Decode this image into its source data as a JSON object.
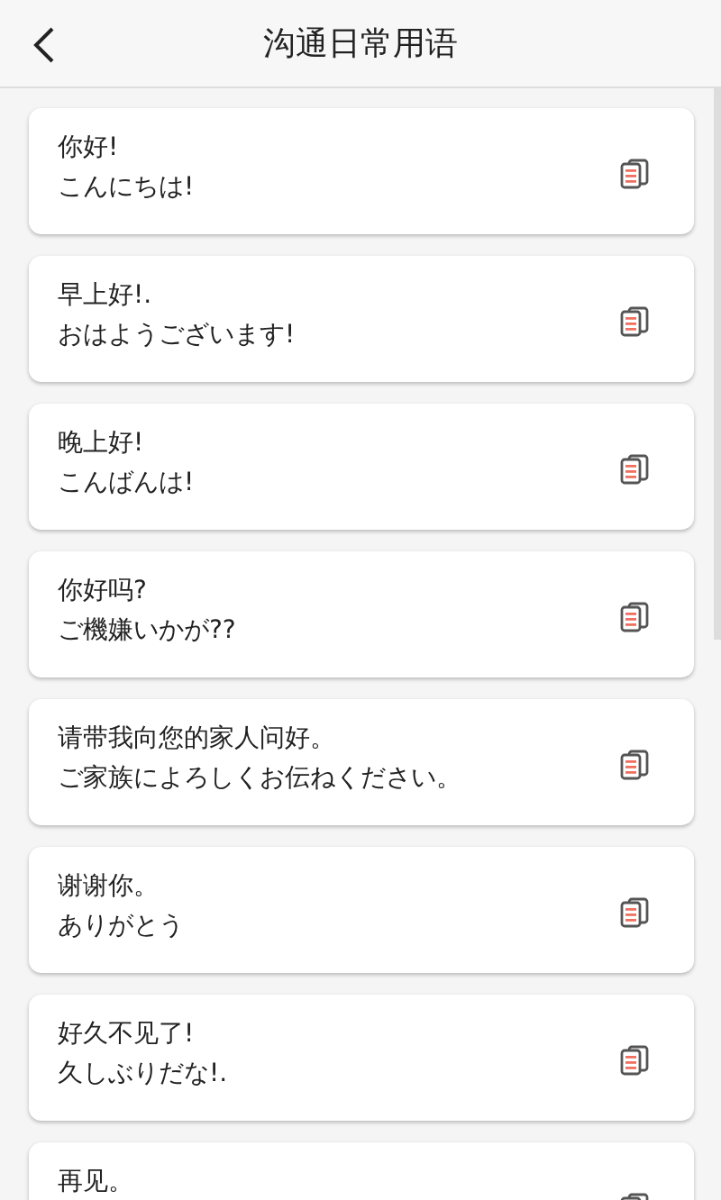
{
  "header": {
    "title": "沟通日常用语"
  },
  "phrases": [
    {
      "chinese": "你好!",
      "japanese": "こんにちは!"
    },
    {
      "chinese": "早上好!.",
      "japanese": "おはようございます!"
    },
    {
      "chinese": "晚上好!",
      "japanese": "こんばんは!"
    },
    {
      "chinese": "你好吗?",
      "japanese": "ご機嫌いかが??"
    },
    {
      "chinese": "请带我向您的家人问好。",
      "japanese": "ご家族によろしくお伝ねください。"
    },
    {
      "chinese": "谢谢你。",
      "japanese": "ありがとう"
    },
    {
      "chinese": "好久不见了!",
      "japanese": "久しぶりだな!."
    },
    {
      "chinese": "再见。"
    }
  ]
}
